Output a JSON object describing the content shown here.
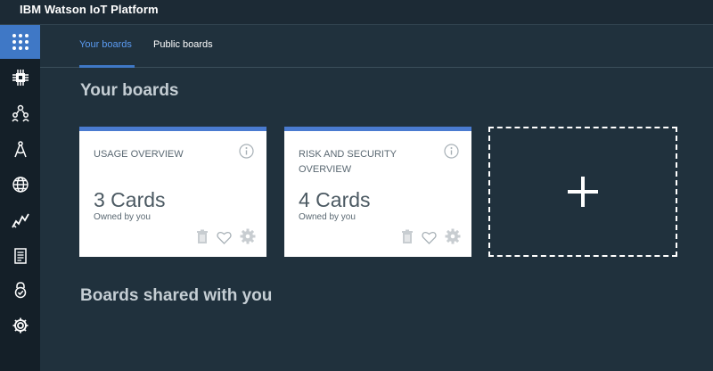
{
  "app": {
    "title": "IBM Watson IoT Platform"
  },
  "sidebar": {
    "items": [
      {
        "icon": "apps-grid-icon",
        "active": true
      },
      {
        "icon": "chip-icon"
      },
      {
        "icon": "members-icon"
      },
      {
        "icon": "compass-icon"
      },
      {
        "icon": "security-globe-icon"
      },
      {
        "icon": "analytics-icon"
      },
      {
        "icon": "document-icon"
      },
      {
        "icon": "lock-check-icon"
      },
      {
        "icon": "settings-icon"
      }
    ]
  },
  "tabs": [
    {
      "label": "Your boards",
      "active": true
    },
    {
      "label": "Public boards",
      "active": false
    }
  ],
  "sections": {
    "your_boards_title": "Your boards",
    "shared_title": "Boards shared with you"
  },
  "boards": [
    {
      "title": "USAGE OVERVIEW",
      "count": "3 Cards",
      "owner": "Owned by you"
    },
    {
      "title": "RISK AND SECURITY OVERVIEW",
      "count": "4 Cards",
      "owner": "Owned by you"
    }
  ],
  "add_board": {
    "icon": "plus-icon"
  },
  "colors": {
    "background": "#20313d",
    "sidebar": "#141f28",
    "accent": "#3f78c6",
    "tab_active": "#5b9bf2",
    "card_top_border": "#4a7bd0"
  }
}
